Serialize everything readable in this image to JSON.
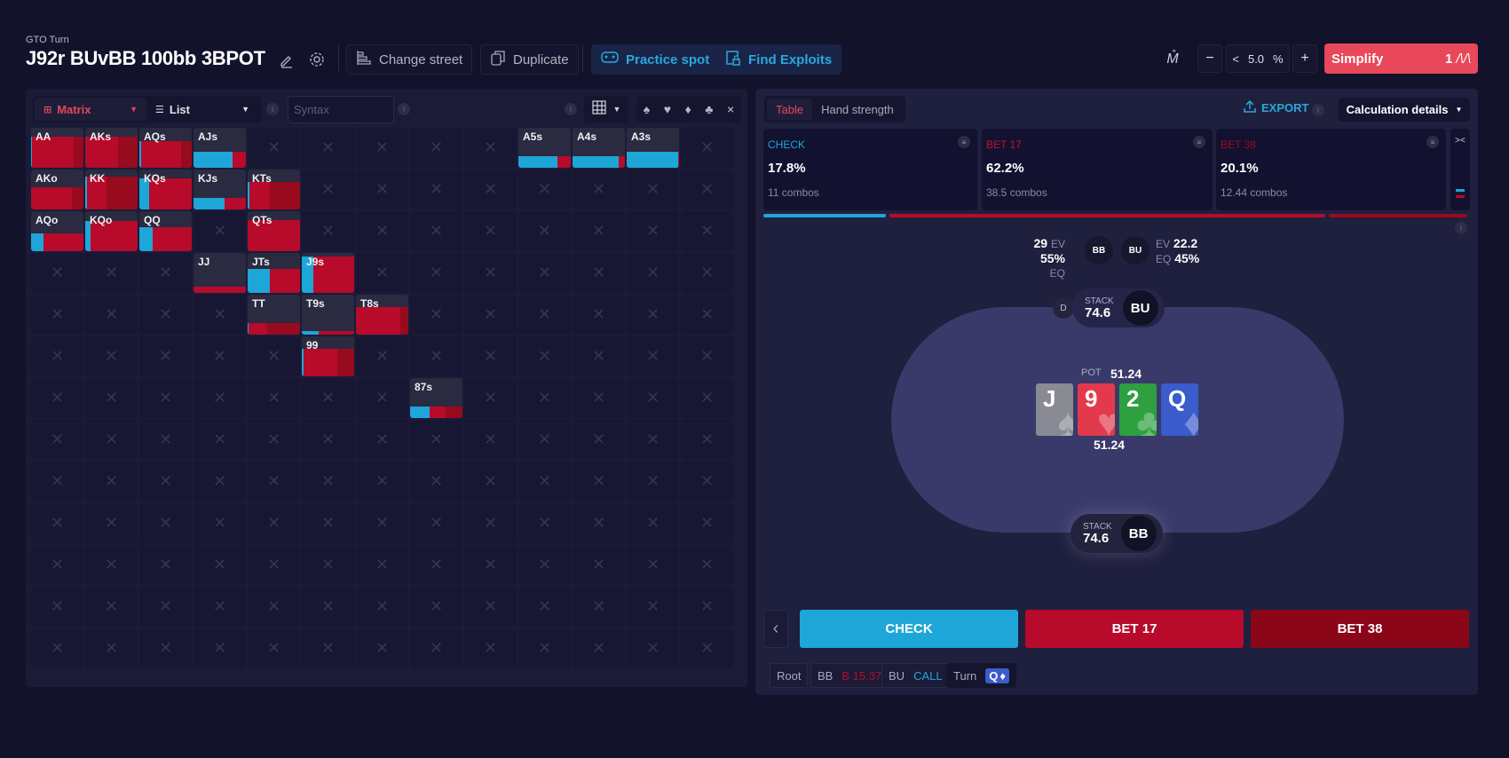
{
  "header": {
    "subtitle": "GTO Turn",
    "title": "J92r BUvBB 100bb 3BPOT",
    "buttons": {
      "change_street": "Change street",
      "duplicate": "Duplicate",
      "practice_spot": "Practice spot",
      "find_exploits": "Find Exploits"
    },
    "threshold": {
      "value": "5.0",
      "unit": "%",
      "dec_arrow": "<",
      "minus": "−",
      "plus": "+"
    },
    "simplify": {
      "label": "Simplify",
      "count": "1"
    }
  },
  "left": {
    "view_select": "Matrix",
    "list_select": "List",
    "syntax_placeholder": "Syntax",
    "info": "i",
    "close": "×",
    "empty_mark": "✕",
    "colors": {
      "check": "#1ea6d8",
      "bet17": "#b80a2a",
      "bet38": "#980a1e",
      "header": "#2a2a40"
    },
    "matrix": [
      [
        {
          "h": "AA",
          "f": 0.78,
          "c": 0.02,
          "b1": 0.8,
          "b2": 0.18
        },
        {
          "h": "AKs",
          "f": 0.78,
          "c": 0,
          "b1": 0.62,
          "b2": 0.38
        },
        {
          "h": "AQs",
          "f": 0.66,
          "c": 0.04,
          "b1": 0.76,
          "b2": 0.2
        },
        {
          "h": "AJs",
          "f": 0.4,
          "c": 0.75,
          "b1": 0.25,
          "b2": 0
        },
        null,
        null,
        null,
        null,
        null,
        {
          "h": "A5s",
          "f": 0.3,
          "c": 0.75,
          "b1": 0.25,
          "b2": 0
        },
        {
          "h": "A4s",
          "f": 0.3,
          "c": 0.88,
          "b1": 0.12,
          "b2": 0
        },
        {
          "h": "A3s",
          "f": 0.4,
          "c": 0.98,
          "b1": 0.02,
          "b2": 0
        },
        null
      ],
      [
        {
          "h": "AKo",
          "f": 0.56,
          "c": 0,
          "b1": 0.78,
          "b2": 0.22
        },
        {
          "h": "KK",
          "f": 0.82,
          "c": 0.04,
          "b1": 0.36,
          "b2": 0.6
        },
        {
          "h": "KQs",
          "f": 0.78,
          "c": 0.18,
          "b1": 0.82,
          "b2": 0
        },
        {
          "h": "KJs",
          "f": 0.3,
          "c": 0.6,
          "b1": 0.4,
          "b2": 0
        },
        {
          "h": "KTs",
          "f": 0.7,
          "c": 0.04,
          "b1": 0.38,
          "b2": 0.58
        },
        null,
        null,
        null,
        null,
        null,
        null,
        null,
        null
      ],
      [
        {
          "h": "AQo",
          "f": 0.45,
          "c": 0.24,
          "b1": 0.76,
          "b2": 0
        },
        {
          "h": "KQo",
          "f": 0.76,
          "c": 0.1,
          "b1": 0.9,
          "b2": 0
        },
        {
          "h": "QQ",
          "f": 0.6,
          "c": 0.25,
          "b1": 0.75,
          "b2": 0
        },
        null,
        {
          "h": "QTs",
          "f": 0.78,
          "c": 0,
          "b1": 1,
          "b2": 0
        },
        null,
        null,
        null,
        null,
        null,
        null,
        null,
        null
      ],
      [
        null,
        null,
        null,
        {
          "h": "JJ",
          "f": 0.15,
          "c": 0,
          "b1": 1,
          "b2": 0
        },
        {
          "h": "JTs",
          "f": 0.6,
          "c": 0.42,
          "b1": 0.58,
          "b2": 0
        },
        {
          "h": "J9s",
          "f": 0.92,
          "c": 0.22,
          "b1": 0.78,
          "b2": 0
        },
        null,
        null,
        null,
        null,
        null,
        null,
        null
      ],
      [
        null,
        null,
        null,
        null,
        {
          "h": "TT",
          "f": 0.28,
          "c": 0.02,
          "b1": 0.36,
          "b2": 0.62
        },
        {
          "h": "T9s",
          "f": 0.1,
          "c": 0.32,
          "b1": 0.68,
          "b2": 0
        },
        {
          "h": "T8s",
          "f": 0.7,
          "c": 0,
          "b1": 0.84,
          "b2": 0.16
        },
        null,
        null,
        null,
        null,
        null,
        null
      ],
      [
        null,
        null,
        null,
        null,
        null,
        {
          "h": "99",
          "f": 0.7,
          "c": 0.04,
          "b1": 0.64,
          "b2": 0.32
        },
        null,
        null,
        null,
        null,
        null,
        null,
        null
      ],
      [
        null,
        null,
        null,
        null,
        null,
        null,
        null,
        {
          "h": "87s",
          "f": 0.3,
          "c": 0.38,
          "b1": 0.3,
          "b2": 0.32
        },
        null,
        null,
        null,
        null,
        null
      ],
      [
        null,
        null,
        null,
        null,
        null,
        null,
        null,
        null,
        null,
        null,
        null,
        null,
        null
      ],
      [
        null,
        null,
        null,
        null,
        null,
        null,
        null,
        null,
        null,
        null,
        null,
        null,
        null
      ],
      [
        null,
        null,
        null,
        null,
        null,
        null,
        null,
        null,
        null,
        null,
        null,
        null,
        null
      ],
      [
        null,
        null,
        null,
        null,
        null,
        null,
        null,
        null,
        null,
        null,
        null,
        null,
        null
      ],
      [
        null,
        null,
        null,
        null,
        null,
        null,
        null,
        null,
        null,
        null,
        null,
        null,
        null
      ],
      [
        null,
        null,
        null,
        null,
        null,
        null,
        null,
        null,
        null,
        null,
        null,
        null,
        null
      ]
    ]
  },
  "right": {
    "tabs": [
      "Table",
      "Hand strength"
    ],
    "export": "EXPORT",
    "calc_details": "Calculation details",
    "actions": [
      {
        "name": "CHECK",
        "pct": "17.8%",
        "combos": "11 combos",
        "color": "#1ea6d8",
        "freq": 0.178
      },
      {
        "name": "BET 17",
        "pct": "62.2%",
        "combos": "38.5 combos",
        "color": "#b80a2a",
        "freq": 0.622
      },
      {
        "name": "BET 38",
        "pct": "20.1%",
        "combos": "12.44 combos",
        "color": "#980a1e",
        "freq": 0.201
      }
    ],
    "collapse": "><",
    "bb_stats": {
      "ev": "29",
      "eq": "55%"
    },
    "bu_stats": {
      "ev": "22.2",
      "eq": "45%"
    },
    "ev_label": "EV",
    "eq_label": "EQ",
    "positions": {
      "bb": "BB",
      "bu": "BU",
      "dealer": "D"
    },
    "stack_label": "STACK",
    "bu_stack": "74.6",
    "bb_stack": "74.6",
    "pot_label": "POT",
    "pot": "51.24",
    "pot_below": "51.24",
    "board": [
      {
        "rank": "J",
        "suit": "♠",
        "color": "#8a8a94"
      },
      {
        "rank": "9",
        "suit": "♥",
        "color": "#e23a4c"
      },
      {
        "rank": "2",
        "suit": "♣",
        "color": "#2fa040"
      },
      {
        "rank": "Q",
        "suit": "♦",
        "color": "#3a5ccc"
      }
    ],
    "buttons": {
      "back": "‹",
      "check": "CHECK",
      "bet17": "BET 17",
      "bet38": "BET 38"
    },
    "breadcrumb": {
      "root": "Root",
      "bb_pos": "BB",
      "bb_action": "B 15.37",
      "bu_pos": "BU",
      "bu_action": "CALL",
      "street": "Turn",
      "card_rank": "Q",
      "card_suit": "♦"
    }
  }
}
